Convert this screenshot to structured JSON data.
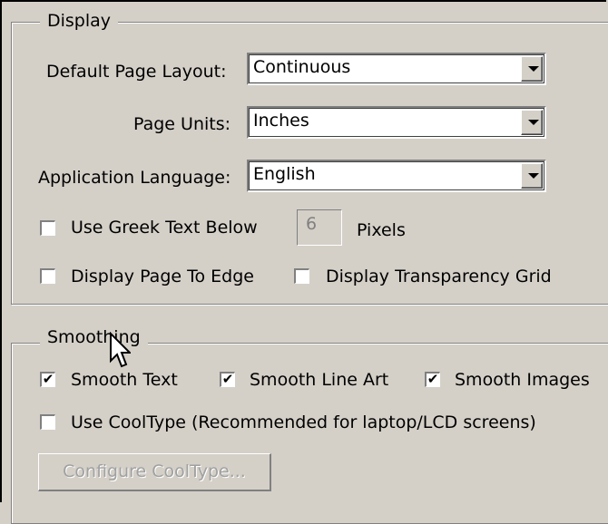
{
  "display": {
    "legend": "Display",
    "default_page_layout": {
      "label": "Default Page Layout:",
      "value": "Continuous"
    },
    "page_units": {
      "label": "Page Units:",
      "value": "Inches"
    },
    "application_language": {
      "label": "Application Language:",
      "value": "English"
    },
    "greek_text": {
      "label": "Use Greek Text Below",
      "value": "6",
      "unit": "Pixels",
      "checked": false
    },
    "page_to_edge": {
      "label": "Display Page To Edge",
      "checked": false
    },
    "transparency_grid": {
      "label": "Display Transparency Grid",
      "checked": false
    }
  },
  "smoothing": {
    "legend": "Smoothing",
    "smooth_text": {
      "label": "Smooth Text",
      "checked": true
    },
    "smooth_line_art": {
      "label": "Smooth Line Art",
      "checked": true
    },
    "smooth_images": {
      "label": "Smooth Images",
      "checked": true
    },
    "cooltype": {
      "label": "Use CoolType (Recommended for laptop/LCD screens)",
      "checked": false
    },
    "configure_button": "Configure CoolType..."
  },
  "check_glyph": "✔"
}
